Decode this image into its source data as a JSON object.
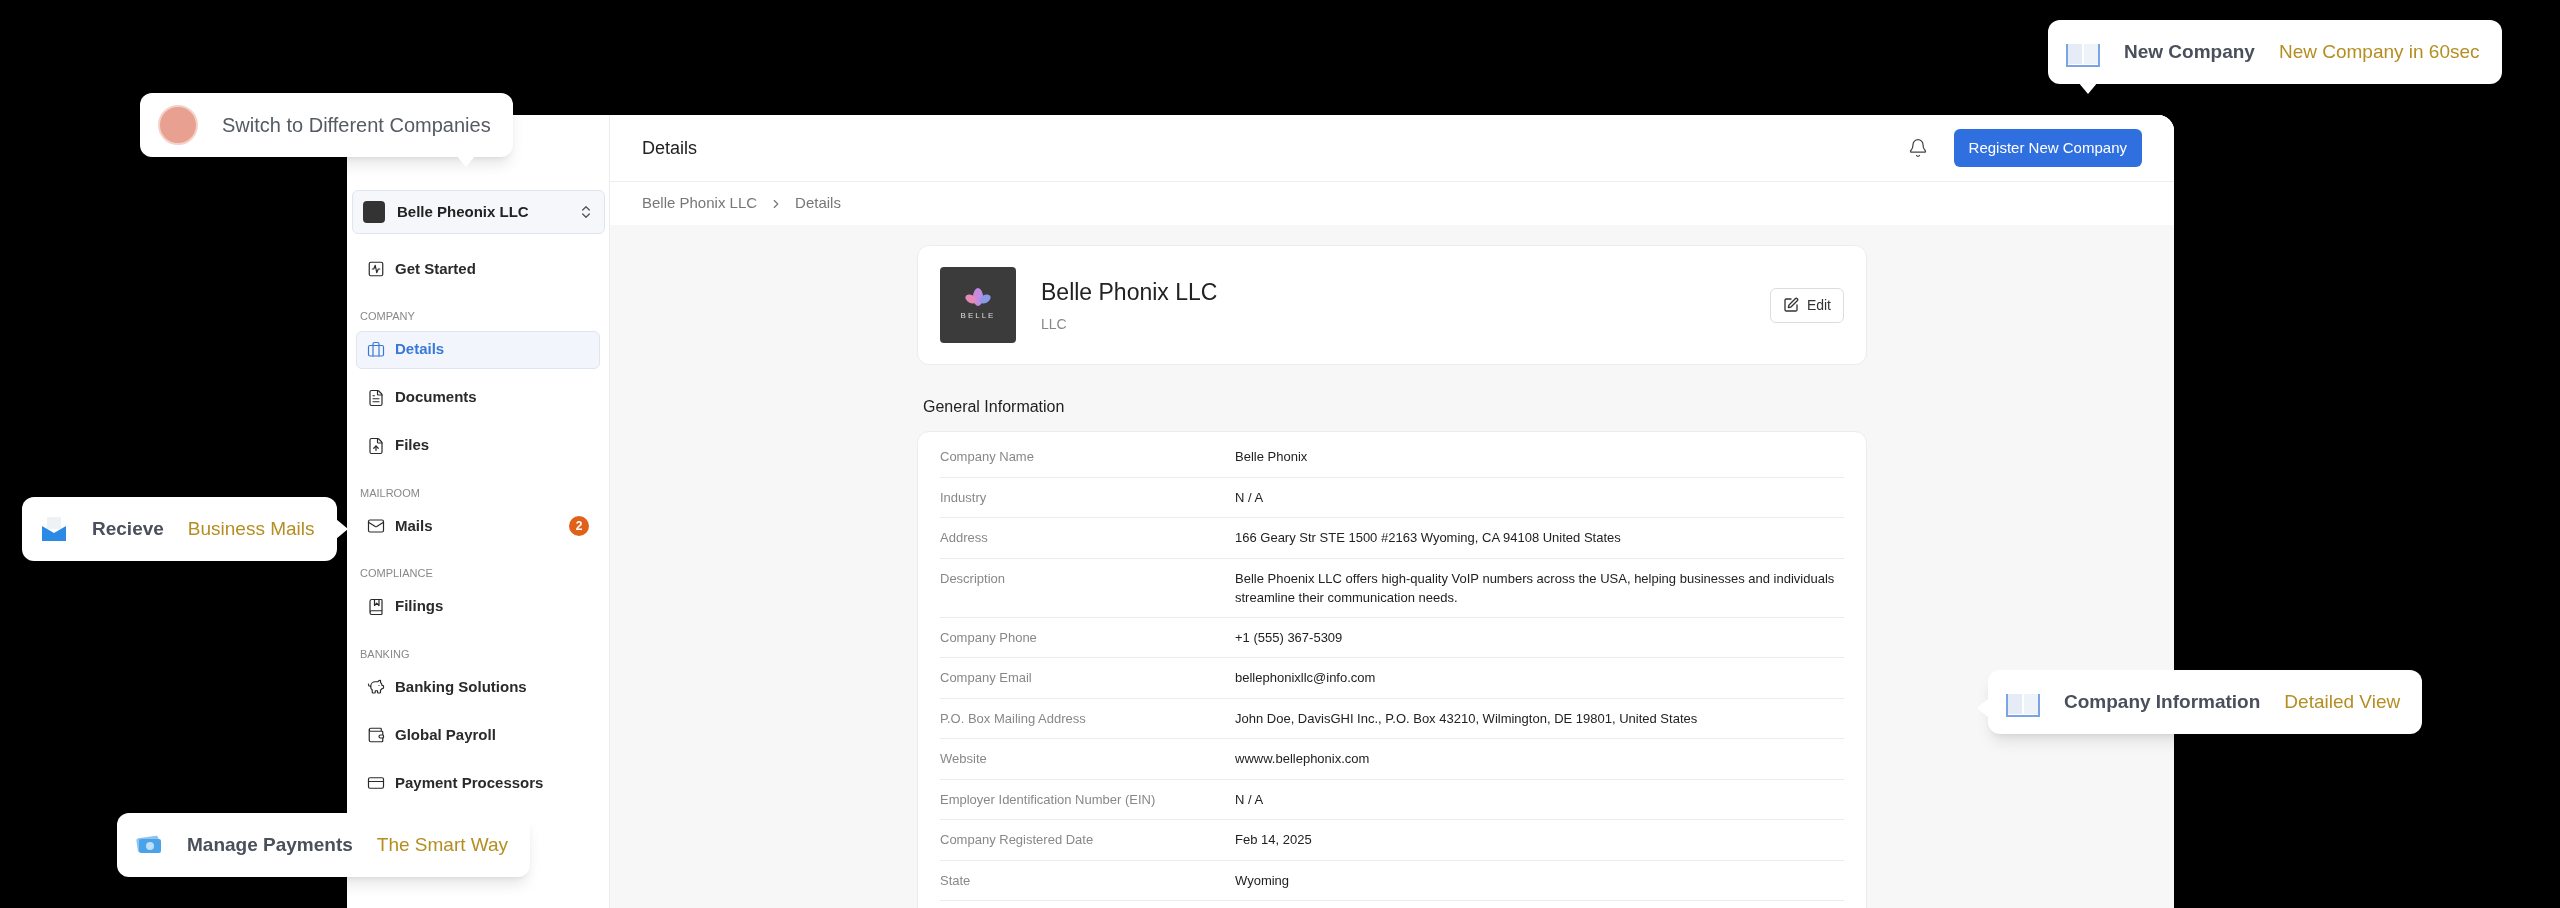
{
  "sidebar": {
    "company_switcher": {
      "name": "Belle Pheonix LLC"
    },
    "sections": [
      {
        "items": [
          {
            "label": "Get Started",
            "selected": false
          }
        ]
      },
      {
        "label": "COMPANY",
        "items": [
          {
            "label": "Details",
            "selected": true
          },
          {
            "label": "Documents",
            "selected": false
          },
          {
            "label": "Files",
            "selected": false
          }
        ]
      },
      {
        "label": "MAILROOM",
        "items": [
          {
            "label": "Mails",
            "selected": false,
            "badge": "2"
          }
        ]
      },
      {
        "label": "COMPLIANCE",
        "items": [
          {
            "label": "Filings",
            "selected": false
          }
        ]
      },
      {
        "label": "BANKING",
        "items": [
          {
            "label": "Banking Solutions",
            "selected": false
          },
          {
            "label": "Global Payroll",
            "selected": false
          },
          {
            "label": "Payment Processors",
            "selected": false
          }
        ]
      }
    ]
  },
  "header": {
    "title": "Details",
    "primary_button": "Register New Company"
  },
  "breadcrumb": [
    "Belle Phonix LLC",
    "Details"
  ],
  "company_card": {
    "logo_text": "BELLE",
    "name": "Belle Phonix LLC",
    "type": "LLC",
    "edit_button": "Edit"
  },
  "general_information": {
    "title": "General Information",
    "rows": [
      {
        "label": "Company Name",
        "value": "Belle Phonix"
      },
      {
        "label": "Industry",
        "value": "N / A"
      },
      {
        "label": "Address",
        "value": "166 Geary Str STE 1500 #2163 Wyoming, CA 94108 United States"
      },
      {
        "label": "Description",
        "value": "Belle Phoenix LLC offers high-quality VoIP numbers across the USA, helping businesses and individuals streamline their communication needs."
      },
      {
        "label": "Company Phone",
        "value": "+1 (555) 367-5309"
      },
      {
        "label": "Company Email",
        "value": "bellephonixllc@info.com"
      },
      {
        "label": "P.O. Box Mailing Address",
        "value": "John Doe, DavisGHI Inc., P.O. Box 43210, Wilmington, DE 19801, United States"
      },
      {
        "label": "Website",
        "value": "wwww.bellephonix.com"
      },
      {
        "label": "Employer Identification Number (EIN)",
        "value": "N / A"
      },
      {
        "label": "Company Registered Date",
        "value": "Feb 14, 2025"
      },
      {
        "label": "State",
        "value": "Wyoming"
      }
    ]
  },
  "callouts": [
    {
      "kind": "avatar",
      "title": "Switch to Different Companies"
    },
    {
      "kind": "mail",
      "title": "Recieve",
      "accent": "Business Mails"
    },
    {
      "kind": "money",
      "title": "Manage Payments",
      "accent": "The Smart Way"
    },
    {
      "kind": "book",
      "title": "New Company",
      "accent": "New Company in 60sec"
    },
    {
      "kind": "book",
      "title": "Company Information",
      "accent": "Detailed View"
    }
  ]
}
